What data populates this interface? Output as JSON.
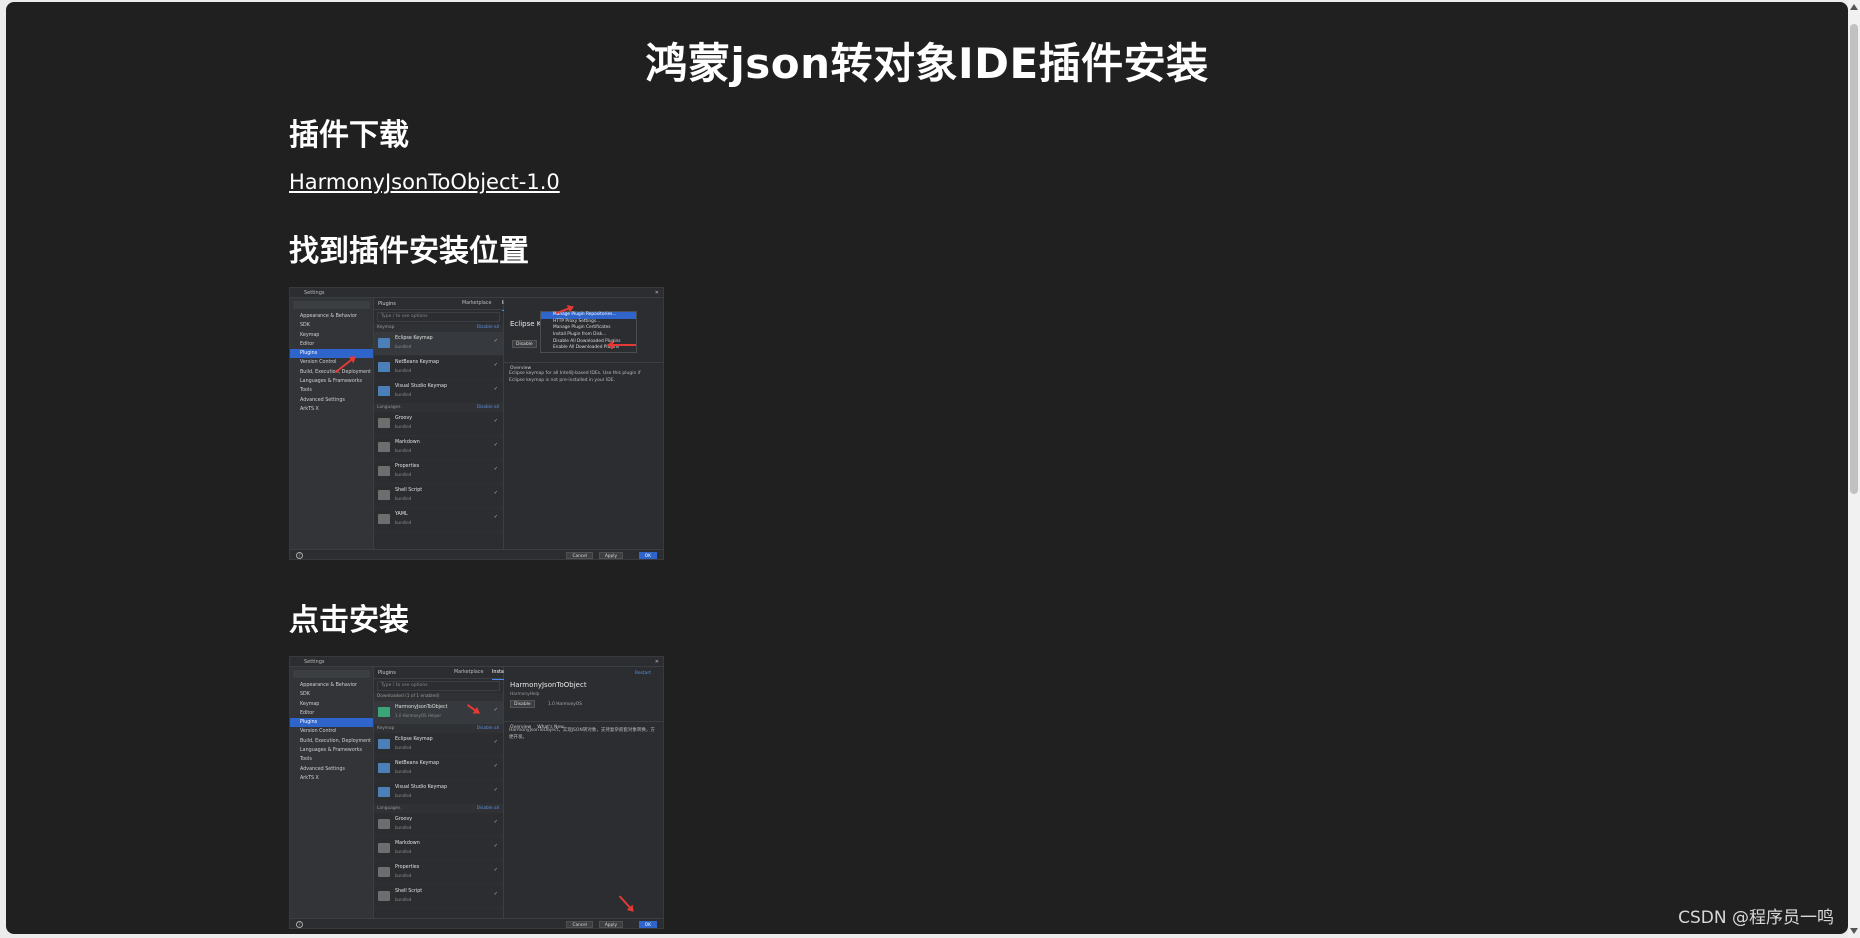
{
  "page": {
    "title": "鸿蒙json转对象IDE插件安装",
    "sections": [
      {
        "heading": "插件下载"
      },
      {
        "heading": "找到插件安装位置"
      },
      {
        "heading": "点击安装"
      }
    ],
    "download_link": "HarmonyJsonToObject-1.0",
    "watermark": "CSDN @程序员一鸣"
  },
  "shot1": {
    "window_title": "Settings",
    "nav": [
      "Appearance & Behavior",
      "SDK",
      "Keymap",
      "Editor",
      "Plugins",
      "Version Control",
      "Build, Execution, Deployment",
      "Languages & Frameworks",
      "Tools",
      "Advanced Settings",
      "ArkTS X"
    ],
    "nav_selected": 4,
    "list_title": "Plugins",
    "tab_marketplace": "Marketplace",
    "tab_installed": "Installed",
    "search_placeholder": "Type / to see options",
    "group1": "Keymap",
    "group2": "Languages",
    "disable_all": "Disable all",
    "plugins": [
      {
        "name": "Eclipse Keymap",
        "status": "bundled"
      },
      {
        "name": "NetBeans Keymap",
        "status": "bundled"
      },
      {
        "name": "Visual Studio Keymap",
        "status": "bundled"
      },
      {
        "name": "Groovy",
        "status": "bundled"
      },
      {
        "name": "Markdown",
        "status": "bundled"
      },
      {
        "name": "Properties",
        "status": "bundled"
      },
      {
        "name": "Shell Script",
        "status": "bundled"
      },
      {
        "name": "YAML",
        "status": "bundled"
      }
    ],
    "detail_title": "Eclipse K",
    "detail_button": "Disable",
    "detail_tab": "Overview",
    "detail_desc": "Eclipse keymap for all IntelliJ-based IDEs. Use this plugin if Eclipse keymap is not pre-installed in your IDE.",
    "menu": [
      "Manage Plugin Repositories...",
      "HTTP Proxy Settings...",
      "Manage Plugin Certificates",
      "Install Plugin from Disk...",
      "Disable All Downloaded Plugins",
      "Enable All Downloaded Plugins"
    ],
    "footer": {
      "cancel": "Cancel",
      "apply": "Apply",
      "ok": "OK",
      "help": "?"
    }
  },
  "shot2": {
    "window_title": "Settings",
    "nav": [
      "Appearance & Behavior",
      "SDK",
      "Keymap",
      "Editor",
      "Plugins",
      "Version Control",
      "Build, Execution, Deployment",
      "Languages & Frameworks",
      "Tools",
      "Advanced Settings",
      "ArkTS X"
    ],
    "nav_selected": 4,
    "list_title": "Plugins",
    "tab_marketplace": "Marketplace",
    "tab_installed": "Installed",
    "search_placeholder": "Type / to see options",
    "group0": "Downloaded (1 of 1 enabled)",
    "group1": "Keymap",
    "group2": "Languages",
    "disable_all": "Disable all",
    "plugins": [
      {
        "name": "HarmonyJsonToObject",
        "status": "1.0 HarmonyOS Helper"
      },
      {
        "name": "Eclipse Keymap",
        "status": "bundled"
      },
      {
        "name": "NetBeans Keymap",
        "status": "bundled"
      },
      {
        "name": "Visual Studio Keymap",
        "status": "bundled"
      },
      {
        "name": "Groovy",
        "status": "bundled"
      },
      {
        "name": "Markdown",
        "status": "bundled"
      },
      {
        "name": "Properties",
        "status": "bundled"
      },
      {
        "name": "Shell Script",
        "status": "bundled"
      }
    ],
    "detail_title": "HarmonyJsonToObject",
    "detail_vendor": "HarmonyHelp",
    "detail_button": "Disable",
    "detail_version": "1.0  HarmonyOS",
    "detail_restart": "Restart",
    "detail_tabs": [
      "Overview",
      "What's New"
    ],
    "detail_desc": "HarmonyJsonToObject，实现JSON转对象，支持复杂嵌套对象转换，方便开发。",
    "footer": {
      "cancel": "Cancel",
      "apply": "Apply",
      "ok": "OK",
      "help": "?"
    }
  }
}
